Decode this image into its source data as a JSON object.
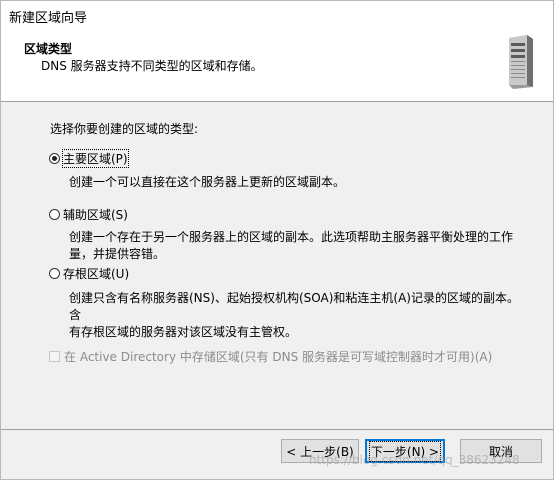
{
  "window": {
    "title": "新建区域向导"
  },
  "header": {
    "title": "区域类型",
    "description": "DNS 服务器支持不同类型的区域和存储。",
    "icon": "server-icon"
  },
  "content": {
    "prompt": "选择你要创建的区域的类型:",
    "options": [
      {
        "label": "主要区域(P)",
        "checked": true,
        "description": "创建一个可以直接在这个服务器上更新的区域副本。"
      },
      {
        "label": "辅助区域(S)",
        "checked": false,
        "description_line1": "创建一个存在于另一个服务器上的区域的副本。此选项帮助主服务器平衡处理的工作",
        "description_line2": "量，并提供容错。"
      },
      {
        "label": "存根区域(U)",
        "checked": false,
        "description_line1": "创建只含有名称服务器(NS)、起始授权机构(SOA)和粘连主机(A)记录的区域的副本。含",
        "description_line2": "有存根区域的服务器对该区域没有主管权。"
      }
    ],
    "ad_checkbox": {
      "label": "在 Active Directory 中存储区域(只有 DNS 服务器是可写域控制器时才可用)(A)",
      "checked": false,
      "enabled": false
    }
  },
  "buttons": {
    "back": "< 上一步(B)",
    "next": "下一步(N) >",
    "cancel": "取消"
  },
  "watermark": "https://blog.csdn.net/qq_38623248",
  "colors": {
    "accent": "#0078d7",
    "header_bg": "#ffffff",
    "body_bg": "#f0f0f0"
  }
}
